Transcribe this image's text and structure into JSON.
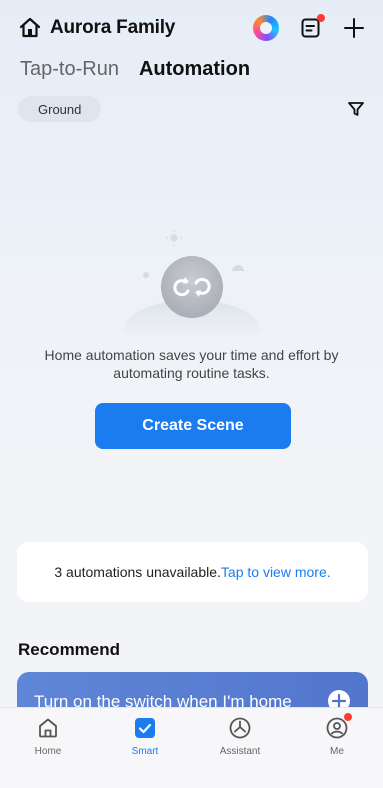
{
  "header": {
    "title": "Aurora Family",
    "icons": [
      "home-icon",
      "assistant-orb-icon",
      "document-icon",
      "plus-icon"
    ],
    "accent": "#1b7cf0",
    "badge_color": "#ff3b30"
  },
  "tabs": {
    "tap_to_run": "Tap-to-Run",
    "automation": "Automation"
  },
  "filter": {
    "room_chip": "Ground"
  },
  "empty_state": {
    "text": "Home automation saves your time and effort by automating routine tasks.",
    "create_button": "Create Scene"
  },
  "unavailable": {
    "text": "3 automations unavailable.",
    "link": "Tap to view more."
  },
  "recommend": {
    "title": "Recommend",
    "card_text": "Turn on the switch when I'm home"
  },
  "tabbar": {
    "items": [
      {
        "label": "Home"
      },
      {
        "label": "Smart"
      },
      {
        "label": "Assistant"
      },
      {
        "label": "Me"
      }
    ]
  }
}
